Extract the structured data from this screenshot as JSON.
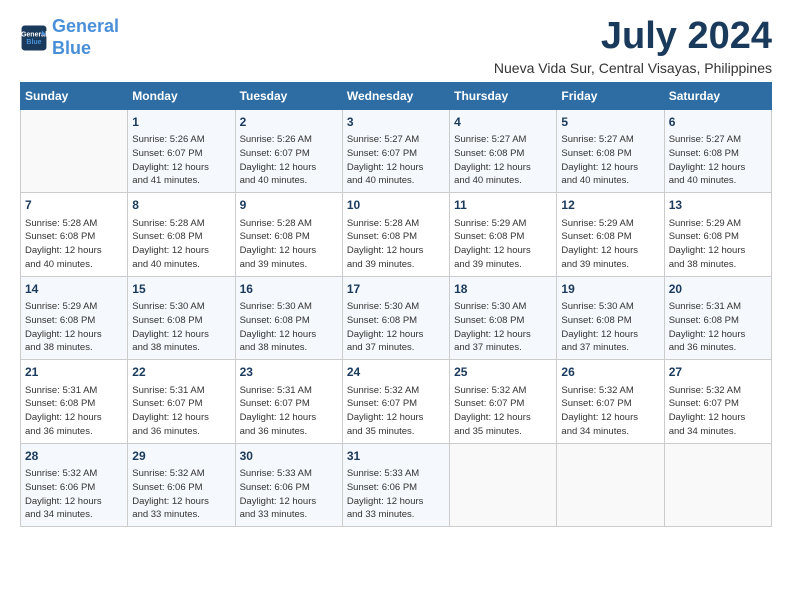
{
  "header": {
    "logo_line1": "General",
    "logo_line2": "Blue",
    "month_year": "July 2024",
    "location": "Nueva Vida Sur, Central Visayas, Philippines"
  },
  "columns": [
    "Sunday",
    "Monday",
    "Tuesday",
    "Wednesday",
    "Thursday",
    "Friday",
    "Saturday"
  ],
  "weeks": [
    [
      {
        "day": "",
        "info": ""
      },
      {
        "day": "1",
        "info": "Sunrise: 5:26 AM\nSunset: 6:07 PM\nDaylight: 12 hours\nand 41 minutes."
      },
      {
        "day": "2",
        "info": "Sunrise: 5:26 AM\nSunset: 6:07 PM\nDaylight: 12 hours\nand 40 minutes."
      },
      {
        "day": "3",
        "info": "Sunrise: 5:27 AM\nSunset: 6:07 PM\nDaylight: 12 hours\nand 40 minutes."
      },
      {
        "day": "4",
        "info": "Sunrise: 5:27 AM\nSunset: 6:08 PM\nDaylight: 12 hours\nand 40 minutes."
      },
      {
        "day": "5",
        "info": "Sunrise: 5:27 AM\nSunset: 6:08 PM\nDaylight: 12 hours\nand 40 minutes."
      },
      {
        "day": "6",
        "info": "Sunrise: 5:27 AM\nSunset: 6:08 PM\nDaylight: 12 hours\nand 40 minutes."
      }
    ],
    [
      {
        "day": "7",
        "info": "Sunrise: 5:28 AM\nSunset: 6:08 PM\nDaylight: 12 hours\nand 40 minutes."
      },
      {
        "day": "8",
        "info": "Sunrise: 5:28 AM\nSunset: 6:08 PM\nDaylight: 12 hours\nand 40 minutes."
      },
      {
        "day": "9",
        "info": "Sunrise: 5:28 AM\nSunset: 6:08 PM\nDaylight: 12 hours\nand 39 minutes."
      },
      {
        "day": "10",
        "info": "Sunrise: 5:28 AM\nSunset: 6:08 PM\nDaylight: 12 hours\nand 39 minutes."
      },
      {
        "day": "11",
        "info": "Sunrise: 5:29 AM\nSunset: 6:08 PM\nDaylight: 12 hours\nand 39 minutes."
      },
      {
        "day": "12",
        "info": "Sunrise: 5:29 AM\nSunset: 6:08 PM\nDaylight: 12 hours\nand 39 minutes."
      },
      {
        "day": "13",
        "info": "Sunrise: 5:29 AM\nSunset: 6:08 PM\nDaylight: 12 hours\nand 38 minutes."
      }
    ],
    [
      {
        "day": "14",
        "info": "Sunrise: 5:29 AM\nSunset: 6:08 PM\nDaylight: 12 hours\nand 38 minutes."
      },
      {
        "day": "15",
        "info": "Sunrise: 5:30 AM\nSunset: 6:08 PM\nDaylight: 12 hours\nand 38 minutes."
      },
      {
        "day": "16",
        "info": "Sunrise: 5:30 AM\nSunset: 6:08 PM\nDaylight: 12 hours\nand 38 minutes."
      },
      {
        "day": "17",
        "info": "Sunrise: 5:30 AM\nSunset: 6:08 PM\nDaylight: 12 hours\nand 37 minutes."
      },
      {
        "day": "18",
        "info": "Sunrise: 5:30 AM\nSunset: 6:08 PM\nDaylight: 12 hours\nand 37 minutes."
      },
      {
        "day": "19",
        "info": "Sunrise: 5:30 AM\nSunset: 6:08 PM\nDaylight: 12 hours\nand 37 minutes."
      },
      {
        "day": "20",
        "info": "Sunrise: 5:31 AM\nSunset: 6:08 PM\nDaylight: 12 hours\nand 36 minutes."
      }
    ],
    [
      {
        "day": "21",
        "info": "Sunrise: 5:31 AM\nSunset: 6:08 PM\nDaylight: 12 hours\nand 36 minutes."
      },
      {
        "day": "22",
        "info": "Sunrise: 5:31 AM\nSunset: 6:07 PM\nDaylight: 12 hours\nand 36 minutes."
      },
      {
        "day": "23",
        "info": "Sunrise: 5:31 AM\nSunset: 6:07 PM\nDaylight: 12 hours\nand 36 minutes."
      },
      {
        "day": "24",
        "info": "Sunrise: 5:32 AM\nSunset: 6:07 PM\nDaylight: 12 hours\nand 35 minutes."
      },
      {
        "day": "25",
        "info": "Sunrise: 5:32 AM\nSunset: 6:07 PM\nDaylight: 12 hours\nand 35 minutes."
      },
      {
        "day": "26",
        "info": "Sunrise: 5:32 AM\nSunset: 6:07 PM\nDaylight: 12 hours\nand 34 minutes."
      },
      {
        "day": "27",
        "info": "Sunrise: 5:32 AM\nSunset: 6:07 PM\nDaylight: 12 hours\nand 34 minutes."
      }
    ],
    [
      {
        "day": "28",
        "info": "Sunrise: 5:32 AM\nSunset: 6:06 PM\nDaylight: 12 hours\nand 34 minutes."
      },
      {
        "day": "29",
        "info": "Sunrise: 5:32 AM\nSunset: 6:06 PM\nDaylight: 12 hours\nand 33 minutes."
      },
      {
        "day": "30",
        "info": "Sunrise: 5:33 AM\nSunset: 6:06 PM\nDaylight: 12 hours\nand 33 minutes."
      },
      {
        "day": "31",
        "info": "Sunrise: 5:33 AM\nSunset: 6:06 PM\nDaylight: 12 hours\nand 33 minutes."
      },
      {
        "day": "",
        "info": ""
      },
      {
        "day": "",
        "info": ""
      },
      {
        "day": "",
        "info": ""
      }
    ]
  ]
}
